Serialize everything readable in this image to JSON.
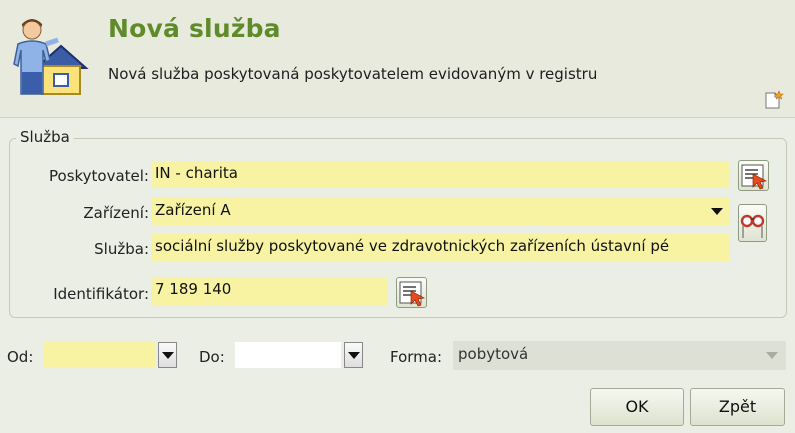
{
  "header": {
    "title": "Nová služba",
    "subtitle": "Nová služba poskytovaná poskytovatelem evidovaným v registru"
  },
  "group": {
    "legend": "Služba",
    "poskytovatel": {
      "label": "Poskytovatel:",
      "value": "IN - charita"
    },
    "zarizeni": {
      "label": "Zařízení:",
      "value": "Zařízení A"
    },
    "sluzba": {
      "label": "Služba:",
      "value": "sociální služby poskytované ve zdravotnických zařízeních ústavní pé"
    },
    "identifikator": {
      "label": "Identifikátor:",
      "value": "7 189 140"
    }
  },
  "filters": {
    "od_label": "Od:",
    "od_value": "",
    "do_label": "Do:",
    "do_value": "",
    "forma_label": "Forma:",
    "forma_value": "pobytová"
  },
  "buttons": {
    "ok": "OK",
    "back": "Zpět"
  },
  "icons": {
    "header": "person-house-icon",
    "corner": "new-document-icon",
    "select_provider": "select-list-icon",
    "search": "binoculars-icon",
    "select_identifier": "select-list-icon"
  },
  "colors": {
    "title": "#5f8b2a",
    "field_highlight": "#f7f3a3",
    "background": "#ebeee4"
  }
}
